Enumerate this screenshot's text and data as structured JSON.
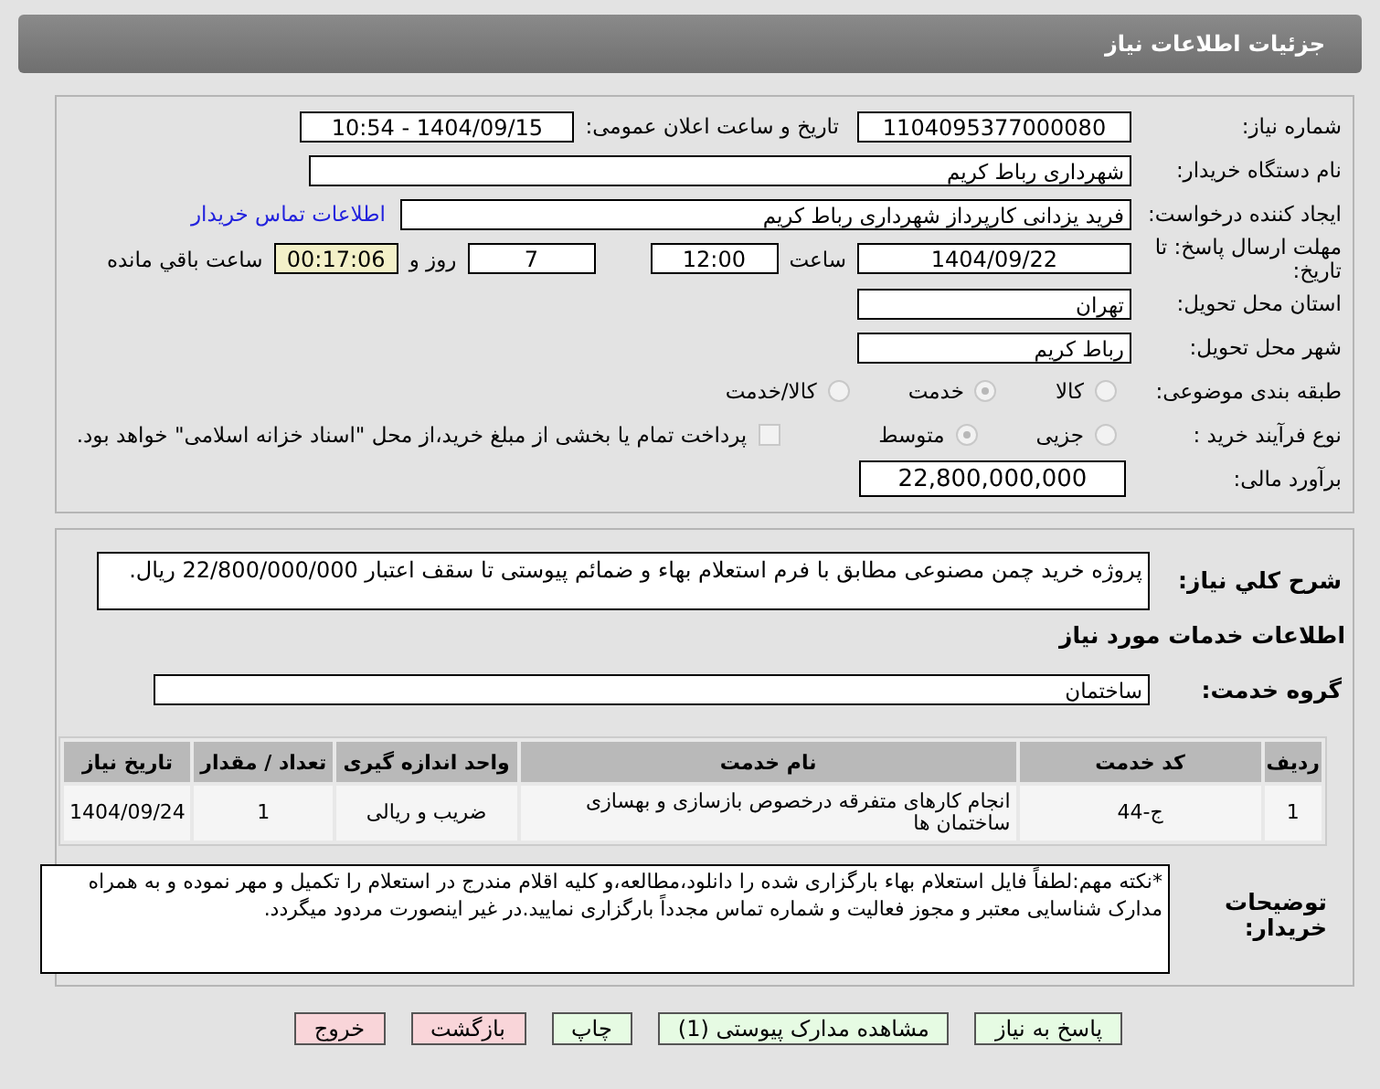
{
  "header": {
    "title": "جزئیات اطلاعات نیاز"
  },
  "need_number": {
    "label": "شماره نیاز:",
    "value": "1104095377000080"
  },
  "announce": {
    "label": "تاریخ و ساعت اعلان عمومی:",
    "value": "1404/09/15 - 10:54"
  },
  "buyer": {
    "label": "نام دستگاه خریدار:",
    "value": "شهرداری رباط کریم"
  },
  "creator": {
    "label": "ایجاد کننده درخواست:",
    "value": "فرید یزدانی کارپرداز شهرداری رباط کریم",
    "link": "اطلاعات تماس خریدار"
  },
  "deadline": {
    "label": "مهلت ارسال پاسخ: تا تاریخ:",
    "date": "1404/09/22",
    "time_label": "ساعت",
    "time": "12:00",
    "days": "7",
    "days_label": "روز و",
    "remaining": "00:17:06",
    "remaining_label": "ساعت باقي مانده"
  },
  "province": {
    "label": "استان محل تحویل:",
    "value": "تهران"
  },
  "city": {
    "label": "شهر محل تحویل:",
    "value": "رباط کریم"
  },
  "category": {
    "label": "طبقه بندی موضوعی:",
    "options": [
      {
        "label": "کالا",
        "selected": false
      },
      {
        "label": "خدمت",
        "selected": true
      },
      {
        "label": "کالا/خدمت",
        "selected": false
      }
    ]
  },
  "process": {
    "label": "نوع فرآیند خرید :",
    "options": [
      {
        "label": "جزیی",
        "selected": false
      },
      {
        "label": "متوسط",
        "selected": true
      }
    ],
    "payment": {
      "label": "پرداخت تمام یا بخشی از مبلغ خرید،از محل \"اسناد خزانه اسلامی\" خواهد بود.",
      "checked": false
    }
  },
  "budget": {
    "label": "برآورد مالی:",
    "value": "22,800,000,000"
  },
  "summary": {
    "label": "شرح کلي نیاز:",
    "value": "پروژه خرید چمن مصنوعی مطابق با فرم استعلام بهاء و ضمائم پیوستی تا سقف اعتبار 22/800/000/000 ریال."
  },
  "services_heading": "اطلاعات خدمات مورد نیاز",
  "service_group": {
    "label": "گروه خدمت:",
    "value": "ساختمان"
  },
  "table": {
    "columns": [
      "ردیف",
      "کد خدمت",
      "نام خدمت",
      "واحد اندازه گیری",
      "تعداد / مقدار",
      "تاریخ نیاز"
    ],
    "rows": [
      [
        "1",
        "ج-44",
        "انجام کارهای متفرقه درخصوص بازسازی و بهسازی ساختمان ها",
        "ضریب و ریالی",
        "1",
        "1404/09/24"
      ]
    ]
  },
  "notes": {
    "label": "توضیحات خریدار:",
    "value": "*نکته مهم:لطفاً فایل استعلام بهاء بارگزاری شده را دانلود،مطالعه،و کلیه اقلام مندرج در استعلام را تکمیل و مهر نموده و به همراه مدارک شناسایی معتبر و مجوز فعالیت و شماره تماس مجدداً بارگزاری نمایید.در غیر اینصورت مردود میگردد."
  },
  "buttons": [
    {
      "label": "پاسخ به نیاز",
      "kind": "action"
    },
    {
      "label": "مشاهده مدارک پیوستی (1)",
      "kind": "action"
    },
    {
      "label": "چاپ",
      "kind": "action"
    },
    {
      "label": "بازگشت",
      "kind": "exit"
    },
    {
      "label": "خروج",
      "kind": "exit"
    }
  ]
}
